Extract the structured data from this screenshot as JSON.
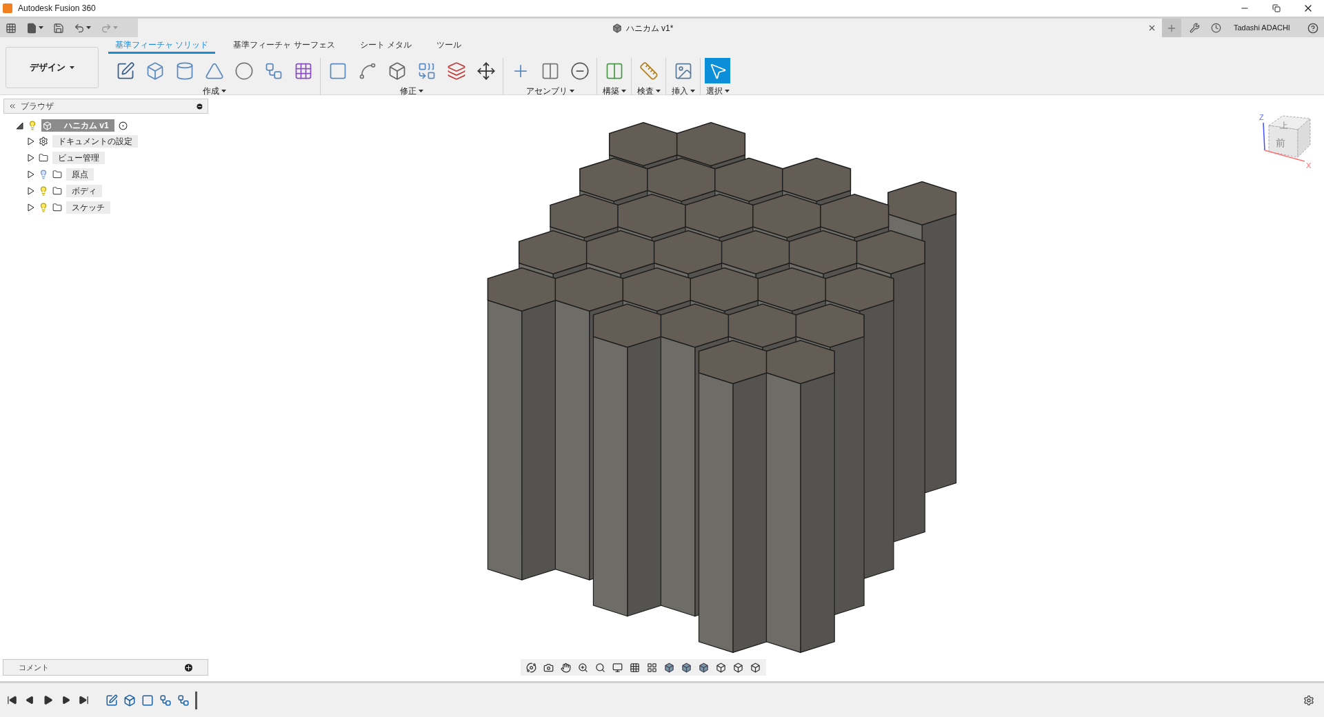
{
  "window": {
    "title": "Autodesk Fusion 360"
  },
  "document_tab": {
    "title": "ハニカム v1*"
  },
  "user": {
    "name": "Tadashi ADACHI"
  },
  "workspace": {
    "label": "デザイン"
  },
  "ribbon_tabs": [
    {
      "label": "基準フィーチャ ソリッド",
      "selected": true
    },
    {
      "label": "基準フィーチャ サーフェス",
      "selected": false
    },
    {
      "label": "シート メタル",
      "selected": false
    },
    {
      "label": "ツール",
      "selected": false
    }
  ],
  "tool_groups": [
    {
      "label": "作成",
      "active": false
    },
    {
      "label": "修正",
      "active": false
    },
    {
      "label": "アセンブリ",
      "active": false
    },
    {
      "label": "構築",
      "active": false
    },
    {
      "label": "検査",
      "active": false
    },
    {
      "label": "挿入",
      "active": false
    },
    {
      "label": "選択",
      "active": true
    }
  ],
  "browser": {
    "title": "ブラウザ",
    "root": {
      "name": "ハニカム v1",
      "expanded": true,
      "visible": true,
      "children": [
        {
          "name": "ドキュメントの設定",
          "kind": "settings",
          "expanded": false
        },
        {
          "name": "ビュー管理",
          "kind": "folder",
          "expanded": false
        },
        {
          "name": "原点",
          "kind": "folder",
          "expanded": false,
          "visible": false
        },
        {
          "name": "ボディ",
          "kind": "folder",
          "expanded": false,
          "visible": true
        },
        {
          "name": "スケッチ",
          "kind": "folder",
          "expanded": false,
          "visible": true
        }
      ]
    }
  },
  "viewcube": {
    "top": "上",
    "front": "前",
    "axis_z": "Z",
    "axis_x": "X"
  },
  "comments": {
    "label": "コメント"
  }
}
